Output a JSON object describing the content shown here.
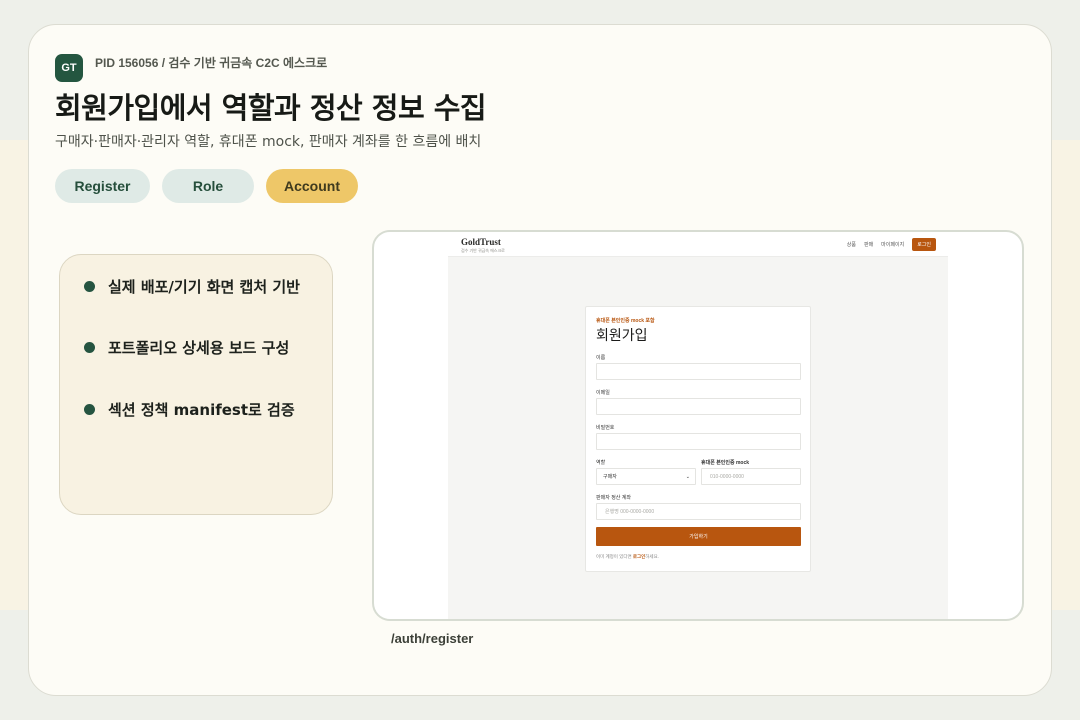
{
  "header": {
    "badge": "GT",
    "pid": "PID 156056 / 검수 기반 귀금속 C2C 에스크로",
    "title": "회원가입에서 역할과 정산 정보 수집",
    "subtitle": "구매자·판매자·관리자 역할, 휴대폰 mock, 판매자 계좌를 한 흐름에 배치"
  },
  "chips": [
    "Register",
    "Role",
    "Account"
  ],
  "notes": [
    "실제 배포/기기 화면 캡처 기반",
    "포트폴리오 상세용 보드 구성",
    "섹션 정책 manifest로 검증"
  ],
  "screenshot": {
    "brand": "GoldTrust",
    "brand_sub": "검수 기반 귀금속 에스크로",
    "nav": [
      "상품",
      "판매",
      "마이페이지"
    ],
    "login": "로그인",
    "form": {
      "eyebrow": "휴대폰 본인인증 mock 포함",
      "title": "회원가입",
      "name_label": "이름",
      "email_label": "이메일",
      "password_label": "비밀번호",
      "role_label": "역할",
      "role_value": "구매자",
      "phone_label": "휴대폰 본인인증 mock",
      "phone_placeholder": "010-0000-0000",
      "account_label": "판매자 정산 계좌",
      "account_placeholder": "은행명 000-0000-0000",
      "submit": "가입하기",
      "footer_prefix": "이미 계정이 있다면 ",
      "footer_link": "로그인",
      "footer_suffix": "하세요."
    }
  },
  "route": "/auth/register",
  "colors": {
    "accent": "#b8560f",
    "brand_green": "#245640",
    "chip_active": "#eec768"
  }
}
